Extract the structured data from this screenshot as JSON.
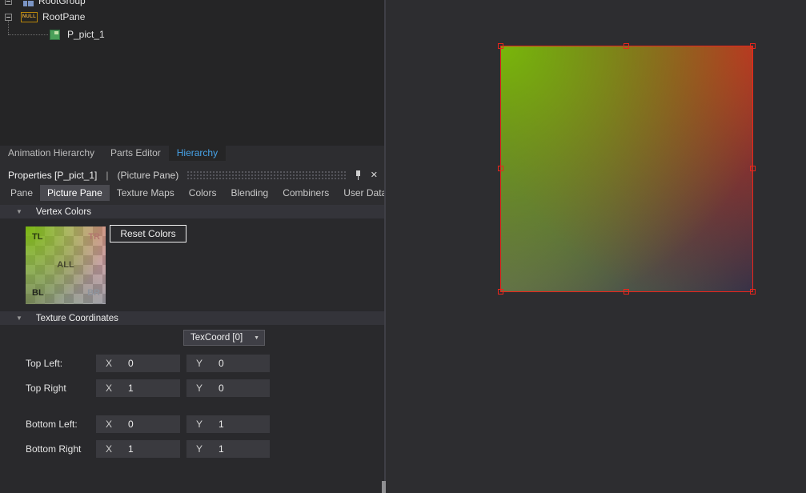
{
  "tree": {
    "items": [
      {
        "label": "RootGroup"
      },
      {
        "label": "RootPane",
        "badge": "NULL"
      },
      {
        "label": "P_pict_1"
      }
    ]
  },
  "dock_tabs": {
    "tabs": [
      {
        "label": "Animation Hierarchy",
        "active": false
      },
      {
        "label": "Parts Editor",
        "active": false
      },
      {
        "label": "Hierarchy",
        "active": true
      }
    ]
  },
  "properties": {
    "title": "Properties [P_pict_1]",
    "separator": "|",
    "subtitle": "(Picture Pane)",
    "tabs": [
      {
        "label": "Pane",
        "active": false
      },
      {
        "label": "Picture Pane",
        "active": true
      },
      {
        "label": "Texture Maps",
        "active": false
      },
      {
        "label": "Colors",
        "active": false
      },
      {
        "label": "Blending",
        "active": false
      },
      {
        "label": "Combiners",
        "active": false
      },
      {
        "label": "User Data",
        "active": false
      }
    ]
  },
  "vertex_colors": {
    "section_label": "Vertex Colors",
    "reset_button_label": "Reset Colors",
    "preview_labels": {
      "tl": "TL",
      "tr": "TR",
      "all": "ALL",
      "bl": "BL",
      "br": "BR"
    }
  },
  "texture_coordinates": {
    "section_label": "Texture Coordinates",
    "dropdown_value": "TexCoord [0]",
    "rows": [
      {
        "label": "Top Left:",
        "x_label": "X",
        "x_value": "0",
        "y_label": "Y",
        "y_value": "0"
      },
      {
        "label": "Top Right",
        "x_label": "X",
        "x_value": "1",
        "y_label": "Y",
        "y_value": "0"
      },
      {
        "label": "Bottom Left:",
        "x_label": "X",
        "x_value": "0",
        "y_label": "Y",
        "y_value": "1"
      },
      {
        "label": "Bottom Right",
        "x_label": "X",
        "x_value": "1",
        "y_label": "Y",
        "y_value": "1"
      }
    ]
  },
  "icons": {
    "close": "✕",
    "section_collapse": "▼",
    "dropdown_caret": "▼"
  },
  "colors": {
    "selection_red": "#e8261c",
    "active_dock_tab_text": "#47a3e8",
    "pane_corner_top_left": "#79b60a",
    "pane_corner_top_right": "#be2d23",
    "pane_corner_bottom_left": "#616c4d",
    "pane_corner_bottom_right": "#242c4a"
  }
}
